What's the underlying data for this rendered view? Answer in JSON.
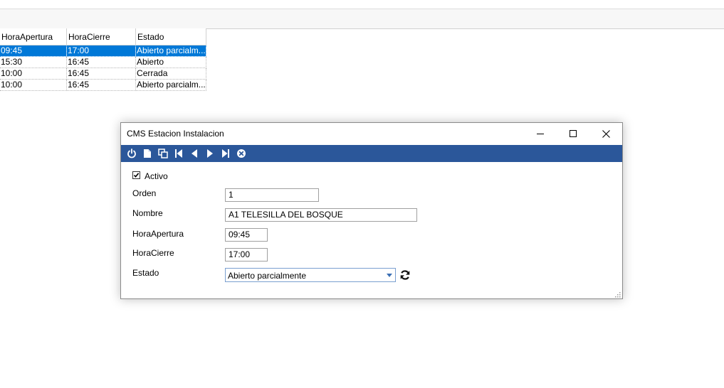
{
  "grid": {
    "columns": [
      "HoraApertura",
      "HoraCierre",
      "Estado"
    ],
    "rows": [
      {
        "apertura": "09:45",
        "cierre": "17:00",
        "estado": "Abierto parcialm...",
        "selected": true
      },
      {
        "apertura": "15:30",
        "cierre": "16:45",
        "estado": "Abierto"
      },
      {
        "apertura": "10:00",
        "cierre": "16:45",
        "estado": "Cerrada"
      },
      {
        "apertura": "10:00",
        "cierre": "16:45",
        "estado": "Abierto parcialm..."
      }
    ]
  },
  "dialog": {
    "title": "CMS Estacion Instalacion",
    "toolbar_icons": [
      "power-icon",
      "new-document-icon",
      "copy-icon",
      "first-record-icon",
      "previous-record-icon",
      "next-record-icon",
      "last-record-icon",
      "cancel-icon"
    ],
    "form": {
      "activo_label": "Activo",
      "activo_checked": true,
      "orden_label": "Orden",
      "orden_value": "1",
      "nombre_label": "Nombre",
      "nombre_value": "A1 TELESILLA DEL BOSQUE",
      "apertura_label": "HoraApertura",
      "apertura_value": "09:45",
      "cierre_label": "HoraCierre",
      "cierre_value": "17:00",
      "estado_label": "Estado",
      "estado_value": "Abierto parcialmente"
    }
  },
  "colors": {
    "toolbar": "#2b579a",
    "selection": "#0078d7"
  }
}
